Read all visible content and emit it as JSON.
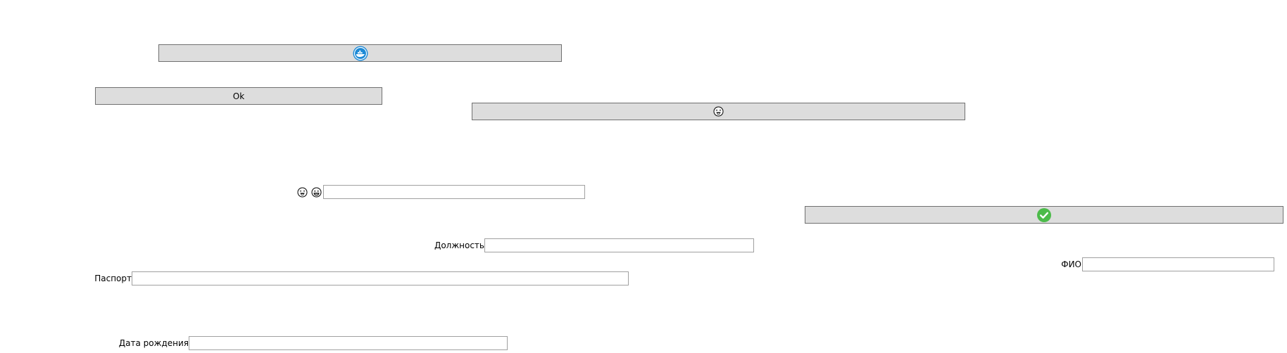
{
  "buttons": {
    "docker": {
      "icon": "docker-whale-icon",
      "color": "#1d8ad6"
    },
    "ok": {
      "label": "Ok"
    },
    "emoji": {
      "icon": "smiley-tongue-icon"
    },
    "confirm": {
      "icon": "checkmark-circle-icon",
      "color": "#4cbb4a"
    }
  },
  "emoji_row": {
    "icons": [
      "grinning-face-icon",
      "smiling-face-icon"
    ]
  },
  "fields": {
    "emoji_input": {
      "value": ""
    },
    "position": {
      "label": "Должность",
      "value": ""
    },
    "fio": {
      "label": "ФИО",
      "value": ""
    },
    "passport": {
      "label": "Паспорт",
      "value": ""
    },
    "birth_date": {
      "label": "Дата рождения",
      "value": ""
    }
  },
  "colors": {
    "button_bg": "#dddddd",
    "button_border": "#707070",
    "field_border": "#a0a0a0"
  }
}
